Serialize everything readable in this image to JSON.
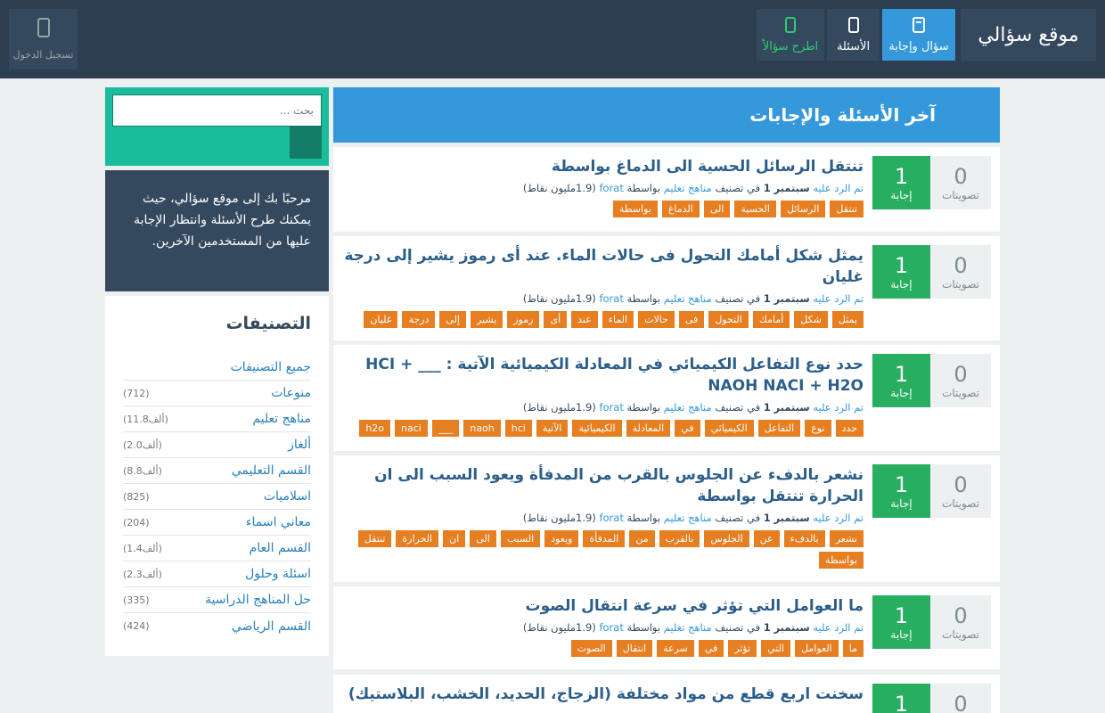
{
  "header": {
    "site_name": "موقع سؤالي",
    "nav": [
      {
        "label": "سؤال وإجابة",
        "icon": "qa-icon"
      },
      {
        "label": "الأسئلة",
        "icon": "question-icon"
      },
      {
        "label": "اطرح سؤالاً",
        "icon": "ask-icon"
      }
    ],
    "login_label": "تسجيل الدخول"
  },
  "search": {
    "placeholder": "بحث ..."
  },
  "welcome": "مرحبًا بك إلى موقع سؤالي، حيث يمكنك طرح الأسئلة وانتظار الإجابة عليها من المستخدمين الآخرين.",
  "categories": {
    "title": "التصنيفات",
    "all_label": "جميع التصنيفات",
    "items": [
      {
        "name": "منوعات",
        "count": "(712)"
      },
      {
        "name": "مناهج تعليم",
        "count": "(11.8ألف)"
      },
      {
        "name": "ألغاز",
        "count": "(2.0ألف)"
      },
      {
        "name": "القسم التعليمي",
        "count": "(8.8ألف)"
      },
      {
        "name": "اسلاميات",
        "count": "(825)"
      },
      {
        "name": "معاني اسماء",
        "count": "(204)"
      },
      {
        "name": "القسم العام",
        "count": "(1.4ألف)"
      },
      {
        "name": "اسئلة وحلول",
        "count": "(2.3ألف)"
      },
      {
        "name": "حل المناهج الدراسية",
        "count": "(335)"
      },
      {
        "name": "القسم الرياضي",
        "count": "(424)"
      }
    ]
  },
  "main": {
    "title": "آخر الأسئلة والإجابات",
    "meta": {
      "answered": "تم الرد عليه",
      "month": "سبتمبر",
      "day": "1",
      "in_cat": "في تصنيف",
      "category": "مناهج تعليم",
      "by": "بواسطة",
      "user": "forat",
      "points": "(1.9مليون نقاط)"
    },
    "vote_label": "تصويتات",
    "answer_label": "إجابة",
    "questions": [
      {
        "votes": "0",
        "answers": "1",
        "title": "تنتقل الرسائل الحسية الى الدماغ بواسطة",
        "tags": [
          "تنتقل",
          "الرسائل",
          "الحسية",
          "الى",
          "الدماغ",
          "بواسطة"
        ]
      },
      {
        "votes": "0",
        "answers": "1",
        "title": "يمثل شكل أمامك التحول فى حالات الماء. عند أى رموز يشير إلى درجة غليان",
        "tags": [
          "يمثل",
          "شكل",
          "أمامك",
          "التحول",
          "فى",
          "حالات",
          "الماء",
          "عند",
          "أى",
          "رموز",
          "يشير",
          "إلى",
          "درجة",
          "غليان"
        ]
      },
      {
        "votes": "0",
        "answers": "1",
        "title": "حدد نوع التفاعل الكيميائي في المعادلة الكيميائية الآتية : ___ HCI + NAOH NACI + H2O",
        "tags": [
          "حدد",
          "نوع",
          "التفاعل",
          "الكيميائي",
          "في",
          "المعادلة",
          "الكيميائية",
          "الآتية",
          "hci",
          "naoh",
          "___",
          "naci",
          "h2o"
        ]
      },
      {
        "votes": "0",
        "answers": "1",
        "title": "نشعر بالدفء عن الجلوس بالقرب من المدفأة ويعود السبب الى ان الحرارة تنتقل بواسطة",
        "tags": [
          "نشعر",
          "بالدفء",
          "عن",
          "الجلوس",
          "بالقرب",
          "من",
          "المدفأة",
          "ويعود",
          "السبب",
          "الى",
          "ان",
          "الحرارة",
          "تنتقل",
          "بواسطة"
        ]
      },
      {
        "votes": "0",
        "answers": "1",
        "title": "ما العوامل التي تؤثر في سرعة انتقال الصوت",
        "tags": [
          "ما",
          "العوامل",
          "التي",
          "تؤثر",
          "في",
          "سرعة",
          "انتقال",
          "الصوت"
        ]
      },
      {
        "votes": "0",
        "answers": "1",
        "title": "سخنت اربع قطع من مواد مختلفة (الزجاج، الحديد، الخشب، البلاستيك)",
        "tags": []
      }
    ]
  }
}
